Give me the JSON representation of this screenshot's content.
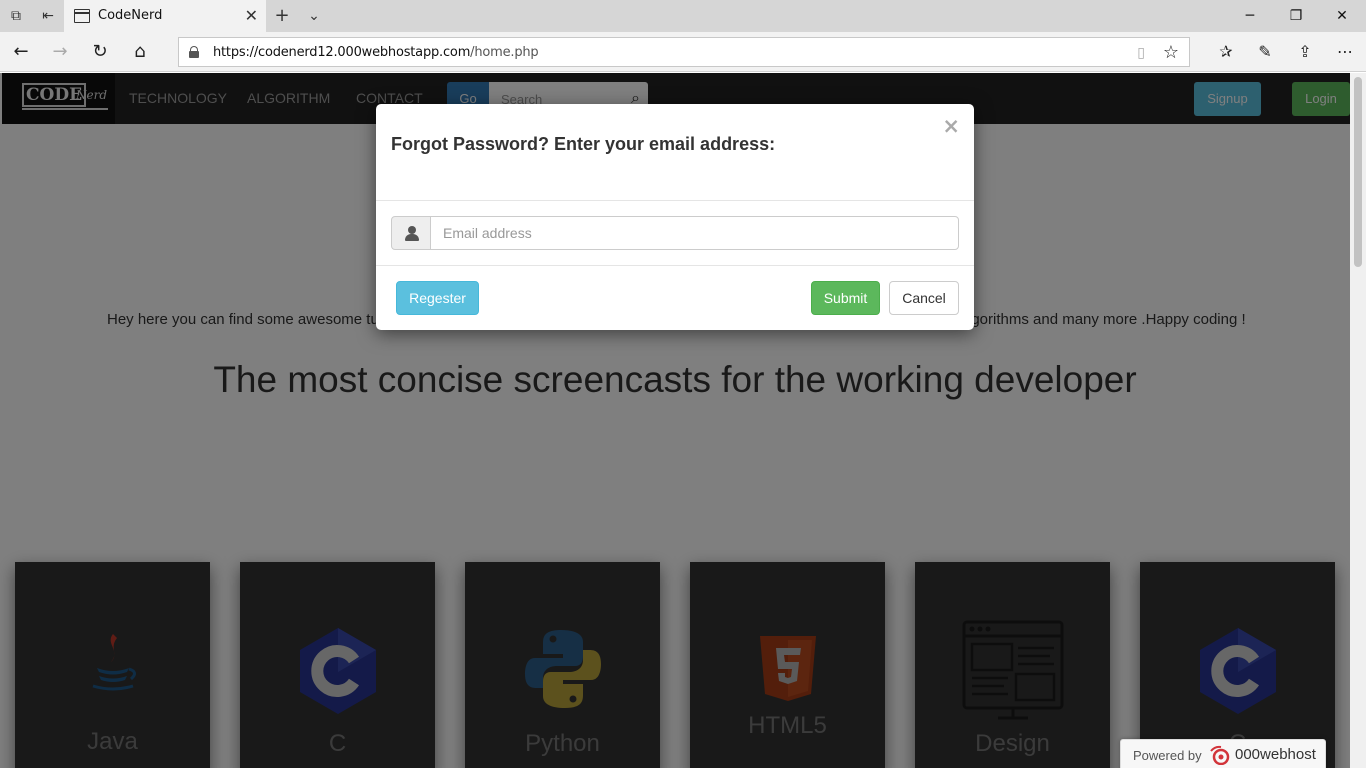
{
  "browser": {
    "tab_title": "CodeNerd",
    "url_host": "https://codenerd12.000webhostapp.com",
    "url_path": "/home.php",
    "icons": [
      "tab-actions-icon",
      "set-aside-icon",
      "page-icon",
      "close-icon",
      "new-tab-icon",
      "tab-preview-icon",
      "back-icon",
      "forward-icon",
      "refresh-icon",
      "home-icon",
      "lock-icon",
      "reading-view-icon",
      "favorite-star-icon",
      "favorites-icon",
      "pen-icon",
      "share-icon",
      "more-icon",
      "minimize-icon",
      "restore-icon",
      "window-close-icon"
    ]
  },
  "site": {
    "logo_code": "CODE",
    "logo_nerd": "Nerd",
    "nav": [
      "TECHNOLOGY",
      "ALGORITHM",
      "CONTACT"
    ],
    "go_label": "Go",
    "search_placeholder": "Search",
    "signup_label": "Signup",
    "login_label": "Login",
    "intro": "Hey here you can find some awesome tu                                                                                                                  lgorithms and many more .Happy coding !",
    "intro_left": "Hey here you can find some awesome tu",
    "intro_right": "lgorithms and many more .Happy coding !",
    "headline": "The most concise screencasts for the working developer",
    "cards": [
      {
        "label": "Java",
        "icon": "java-icon"
      },
      {
        "label": "C",
        "icon": "c-language-icon"
      },
      {
        "label": "Python",
        "icon": "python-icon"
      },
      {
        "label": "HTML5",
        "icon": "html5-icon"
      },
      {
        "label": "Design",
        "icon": "design-icon"
      },
      {
        "label": "C",
        "icon": "c-language-icon"
      }
    ],
    "powered_by": "Powered by",
    "powered_brand": "000webhost"
  },
  "modal": {
    "title": "Forgot Password? Enter your email address:",
    "close": "×",
    "email_placeholder": "Email address",
    "email_value": "",
    "regester_label": "Regester",
    "submit_label": "Submit",
    "cancel_label": "Cancel"
  },
  "colors": {
    "navbar": "#222222",
    "primary": "#337ab7",
    "info": "#5bc0de",
    "success": "#5cb85c",
    "card": "#333333",
    "overlay": "rgba(0,0,0,0.5)"
  }
}
